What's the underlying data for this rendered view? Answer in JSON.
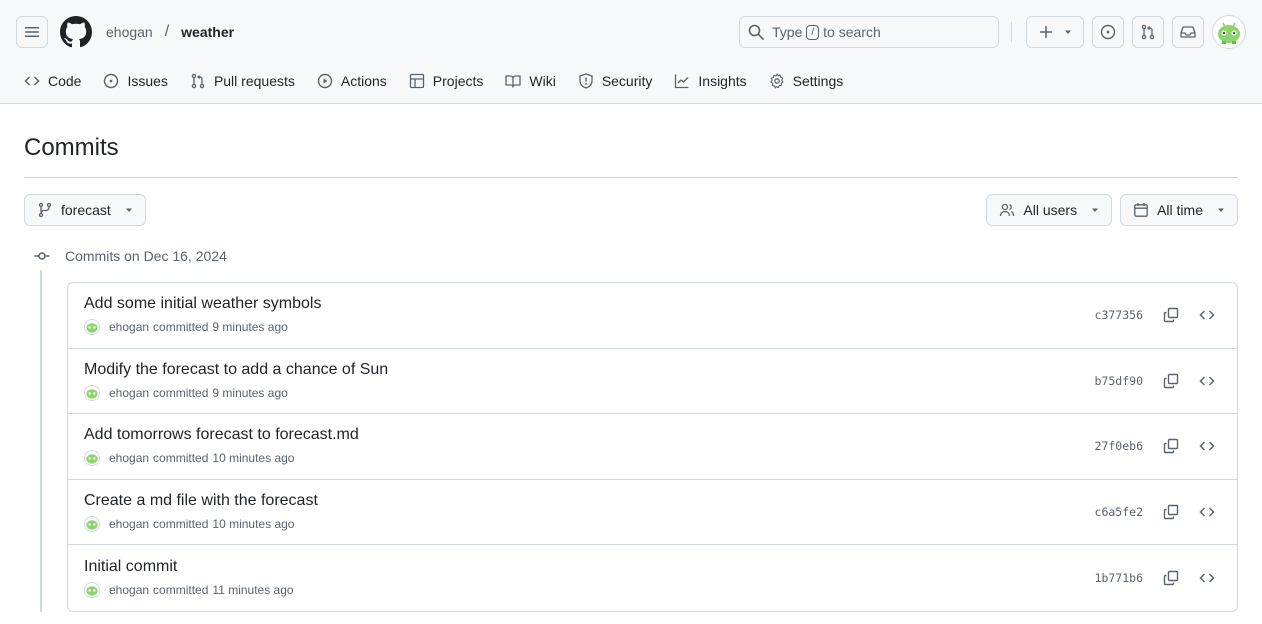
{
  "header": {
    "owner": "ehogan",
    "separator": "/",
    "repo": "weather",
    "search": {
      "prefix": "Type",
      "key": "/",
      "suffix": "to search"
    }
  },
  "nav": [
    {
      "icon": "code-icon",
      "label": "Code"
    },
    {
      "icon": "issue-icon",
      "label": "Issues"
    },
    {
      "icon": "pull-request-icon",
      "label": "Pull requests"
    },
    {
      "icon": "play-icon",
      "label": "Actions"
    },
    {
      "icon": "table-icon",
      "label": "Projects"
    },
    {
      "icon": "book-icon",
      "label": "Wiki"
    },
    {
      "icon": "shield-icon",
      "label": "Security"
    },
    {
      "icon": "graph-icon",
      "label": "Insights"
    },
    {
      "icon": "gear-icon",
      "label": "Settings"
    }
  ],
  "page": {
    "title": "Commits",
    "branch": "forecast",
    "users_filter": "All users",
    "time_filter": "All time",
    "date_group": "Commits on Dec 16, 2024"
  },
  "commits": [
    {
      "message": "Add some initial weather symbols",
      "author": "ehogan",
      "verb": "committed",
      "time": "9 minutes ago",
      "sha": "c377356"
    },
    {
      "message": "Modify the forecast to add a chance of Sun",
      "author": "ehogan",
      "verb": "committed",
      "time": "9 minutes ago",
      "sha": "b75df90"
    },
    {
      "message": "Add tomorrows forecast to forecast.md",
      "author": "ehogan",
      "verb": "committed",
      "time": "10 minutes ago",
      "sha": "27f0eb6"
    },
    {
      "message": "Create a md file with the forecast",
      "author": "ehogan",
      "verb": "committed",
      "time": "10 minutes ago",
      "sha": "c6a5fe2"
    },
    {
      "message": "Initial commit",
      "author": "ehogan",
      "verb": "committed",
      "time": "11 minutes ago",
      "sha": "1b771b6"
    }
  ],
  "colors": {
    "avatar_green": "#8cd56a",
    "border": "#d1d9e0",
    "muted": "#59636e"
  }
}
